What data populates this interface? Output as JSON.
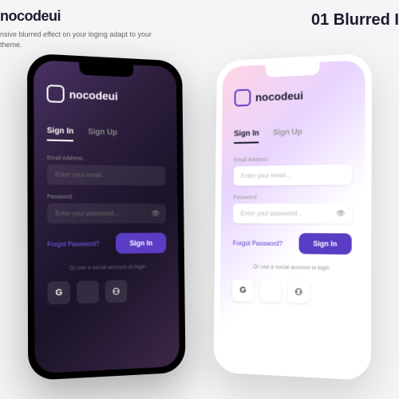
{
  "header": {
    "brand": "nocodeui",
    "tagline": "nsive blurred effect on your loging adapt to your theme.",
    "title_right": "01 Blurred I"
  },
  "app": {
    "logo_text": "nocodeui",
    "tabs": {
      "signin": "Sign In",
      "signup": "Sign Up"
    },
    "email_label": "Email Address",
    "email_placeholder": "Enter your email...",
    "password_label": "Password",
    "password_placeholder": "Enter your password...",
    "forgot": "Forgot Password?",
    "signin_btn": "Sign In",
    "social_text": "Or use a social account to login",
    "social": {
      "google": "G",
      "apple": "",
      "other": "⚇"
    }
  }
}
